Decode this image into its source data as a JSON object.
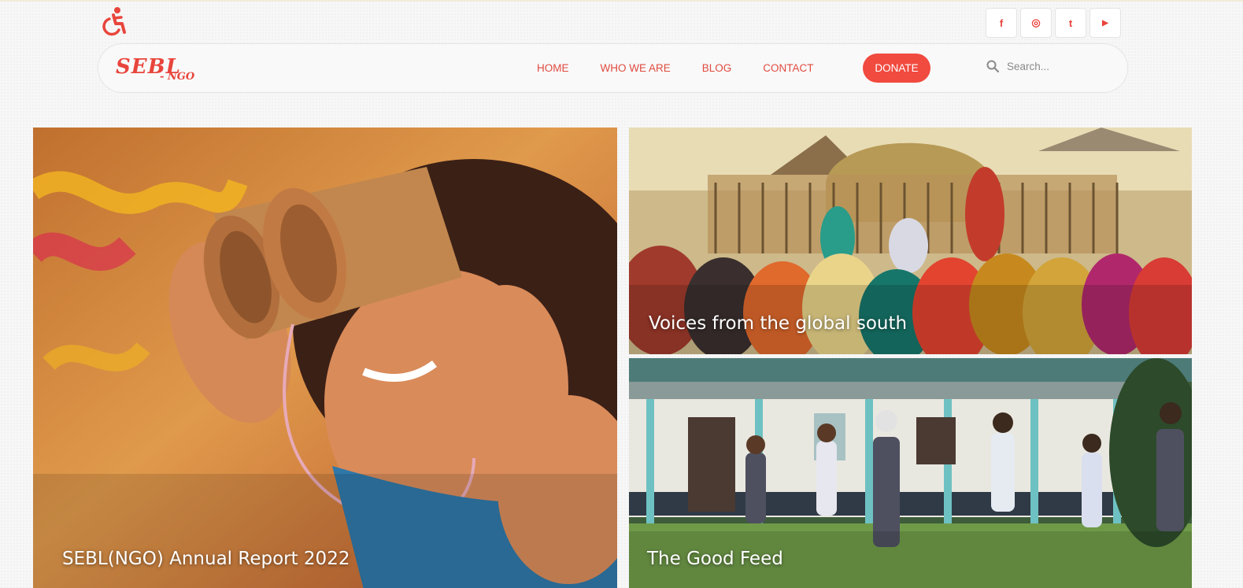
{
  "accessibility": {
    "icon": "wheelchair-icon"
  },
  "social": [
    {
      "name": "facebook",
      "glyph": "f"
    },
    {
      "name": "instagram",
      "glyph": "◎"
    },
    {
      "name": "twitter",
      "glyph": "t"
    },
    {
      "name": "youtube",
      "glyph": "▶"
    }
  ],
  "logo": {
    "line1": "SEBL",
    "line2": "- NGO"
  },
  "nav": {
    "items": [
      {
        "label": "HOME"
      },
      {
        "label": "WHO WE ARE"
      },
      {
        "label": "BLOG"
      },
      {
        "label": "CONTACT"
      }
    ],
    "donate_label": "DONATE"
  },
  "search": {
    "placeholder": "Search..."
  },
  "tiles": {
    "main": {
      "caption": "SEBL(NGO) Annual Report 2022"
    },
    "voices": {
      "caption": "Voices from the global south"
    },
    "feed": {
      "caption": "The Good Feed"
    }
  },
  "colors": {
    "accent": "#f14a3f",
    "link": "#e04b3f"
  }
}
